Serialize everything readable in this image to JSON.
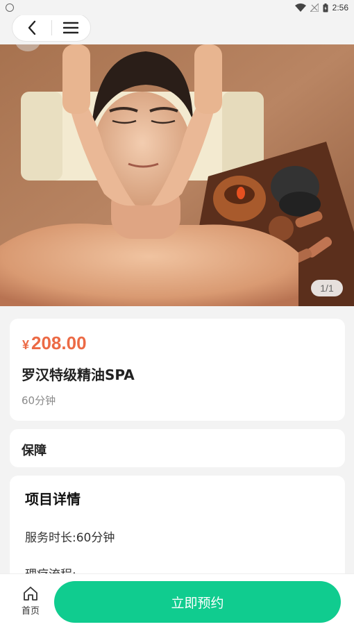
{
  "status_bar": {
    "time": "2:56",
    "icons": [
      "app-notification-icon",
      "wifi-icon",
      "no-signal-icon",
      "battery-icon"
    ]
  },
  "nav": {
    "icons": [
      "back-icon",
      "menu-icon"
    ]
  },
  "gallery": {
    "counter": "1/1"
  },
  "product": {
    "currency_symbol": "¥",
    "price": "208.00",
    "name": "罗汉特级精油SPA",
    "duration": "60分钟"
  },
  "guarantee": {
    "label": "保障"
  },
  "details": {
    "title": "项目详情",
    "service_duration": "服务时长:60分钟",
    "process_label": "理疗流程:"
  },
  "bottom_bar": {
    "home_label": "首页",
    "book_label": "立即预约"
  },
  "colors": {
    "price": "#ec6a45",
    "accent_button": "#10cc8f",
    "background": "#f3f3f3"
  }
}
